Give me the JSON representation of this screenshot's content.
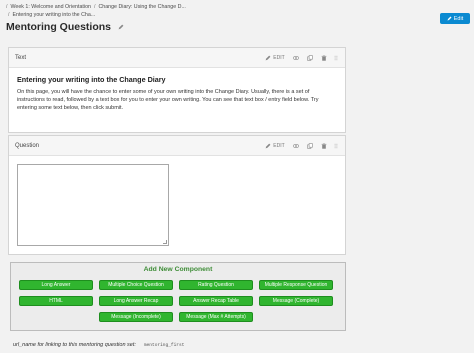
{
  "breadcrumb": {
    "items": [
      "Week 1: Welcome and Orientation",
      "Change Diary: Using the Change D...",
      "Entering your writing into the Cha..."
    ]
  },
  "header": {
    "edit_label": "Edit",
    "title": "Mentoring Questions"
  },
  "text_block": {
    "header_label": "Text",
    "edit_label": "EDIT",
    "heading": "Entering your writing into the Change Diary",
    "body": "On this page, you will have the chance to enter some of your own writing into the Change Diary. Usually, there is a set of instructions to read, followed by a text box for you to enter your own writing. You can see that text box / entry field below. Try entering some text below, then click submit."
  },
  "question_block": {
    "header_label": "Question",
    "edit_label": "EDIT",
    "answer_value": ""
  },
  "add_component": {
    "title": "Add New Component",
    "buttons": [
      "Long Answer",
      "Multiple Choice Question",
      "Rating Question",
      "Multiple Response Question",
      "HTML",
      "Long Answer Recap",
      "Answer Recap Table",
      "Message (Complete)",
      "Message (Incomplete)",
      "Message (Max # Attempts)"
    ]
  },
  "footer": {
    "label": "url_name for linking to this mentoring question set:",
    "value": "mentoring_first"
  },
  "colors": {
    "accent": "#0b8ad1",
    "component_button": "#30b52f",
    "component_title": "#3d8c36"
  },
  "icons": [
    "pencil-icon",
    "eye-icon",
    "duplicate-icon",
    "trash-icon",
    "drag-handle-icon"
  ]
}
